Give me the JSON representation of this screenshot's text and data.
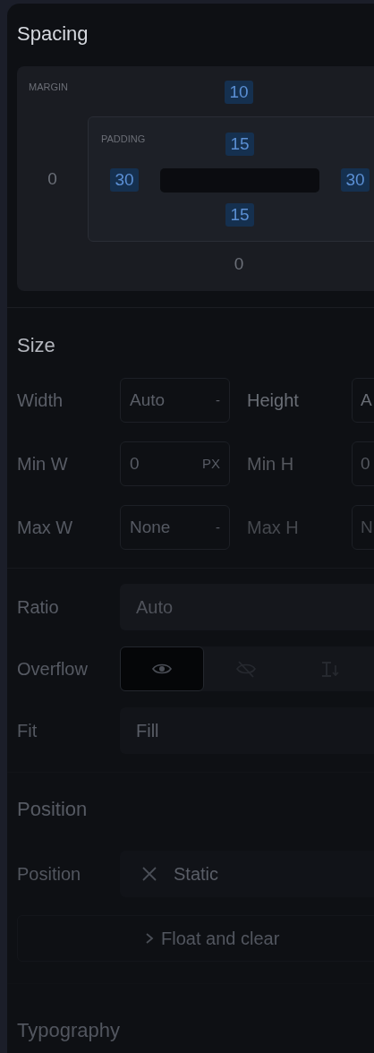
{
  "spacing": {
    "title": "Spacing",
    "margin": {
      "label": "MARGIN",
      "top": {
        "value": "10",
        "set": true
      },
      "left": {
        "value": "0",
        "set": false
      },
      "bottom": {
        "value": "0",
        "set": false
      }
    },
    "padding": {
      "label": "PADDING",
      "top": {
        "value": "15",
        "set": true
      },
      "left": {
        "value": "30",
        "set": true
      },
      "right": {
        "value": "30",
        "set": true
      },
      "bottom": {
        "value": "15",
        "set": true
      }
    }
  },
  "size": {
    "title": "Size",
    "rows": [
      {
        "label": "Width",
        "value": "Auto",
        "unit": "-",
        "label_2": "Height",
        "value_2": "A"
      },
      {
        "label": "Min W",
        "value": "0",
        "unit": "PX",
        "label_2": "Min H",
        "value_2": "0"
      },
      {
        "label": "Max W",
        "value": "None",
        "unit": "-",
        "label_2": "Max H",
        "value_2": "N"
      }
    ]
  },
  "layout": {
    "ratio": {
      "label": "Ratio",
      "value": "Auto"
    },
    "overflow": {
      "label": "Overflow",
      "options": [
        {
          "kind": "visible",
          "selected": true
        },
        {
          "kind": "hidden",
          "selected": false
        },
        {
          "kind": "scroll",
          "selected": false
        }
      ]
    },
    "fit": {
      "label": "Fit",
      "value": "Fill"
    }
  },
  "position": {
    "title": "Position",
    "field": {
      "label": "Position",
      "value": "Static"
    },
    "float_button": "Float and clear"
  },
  "typography": {
    "title": "Typography"
  }
}
